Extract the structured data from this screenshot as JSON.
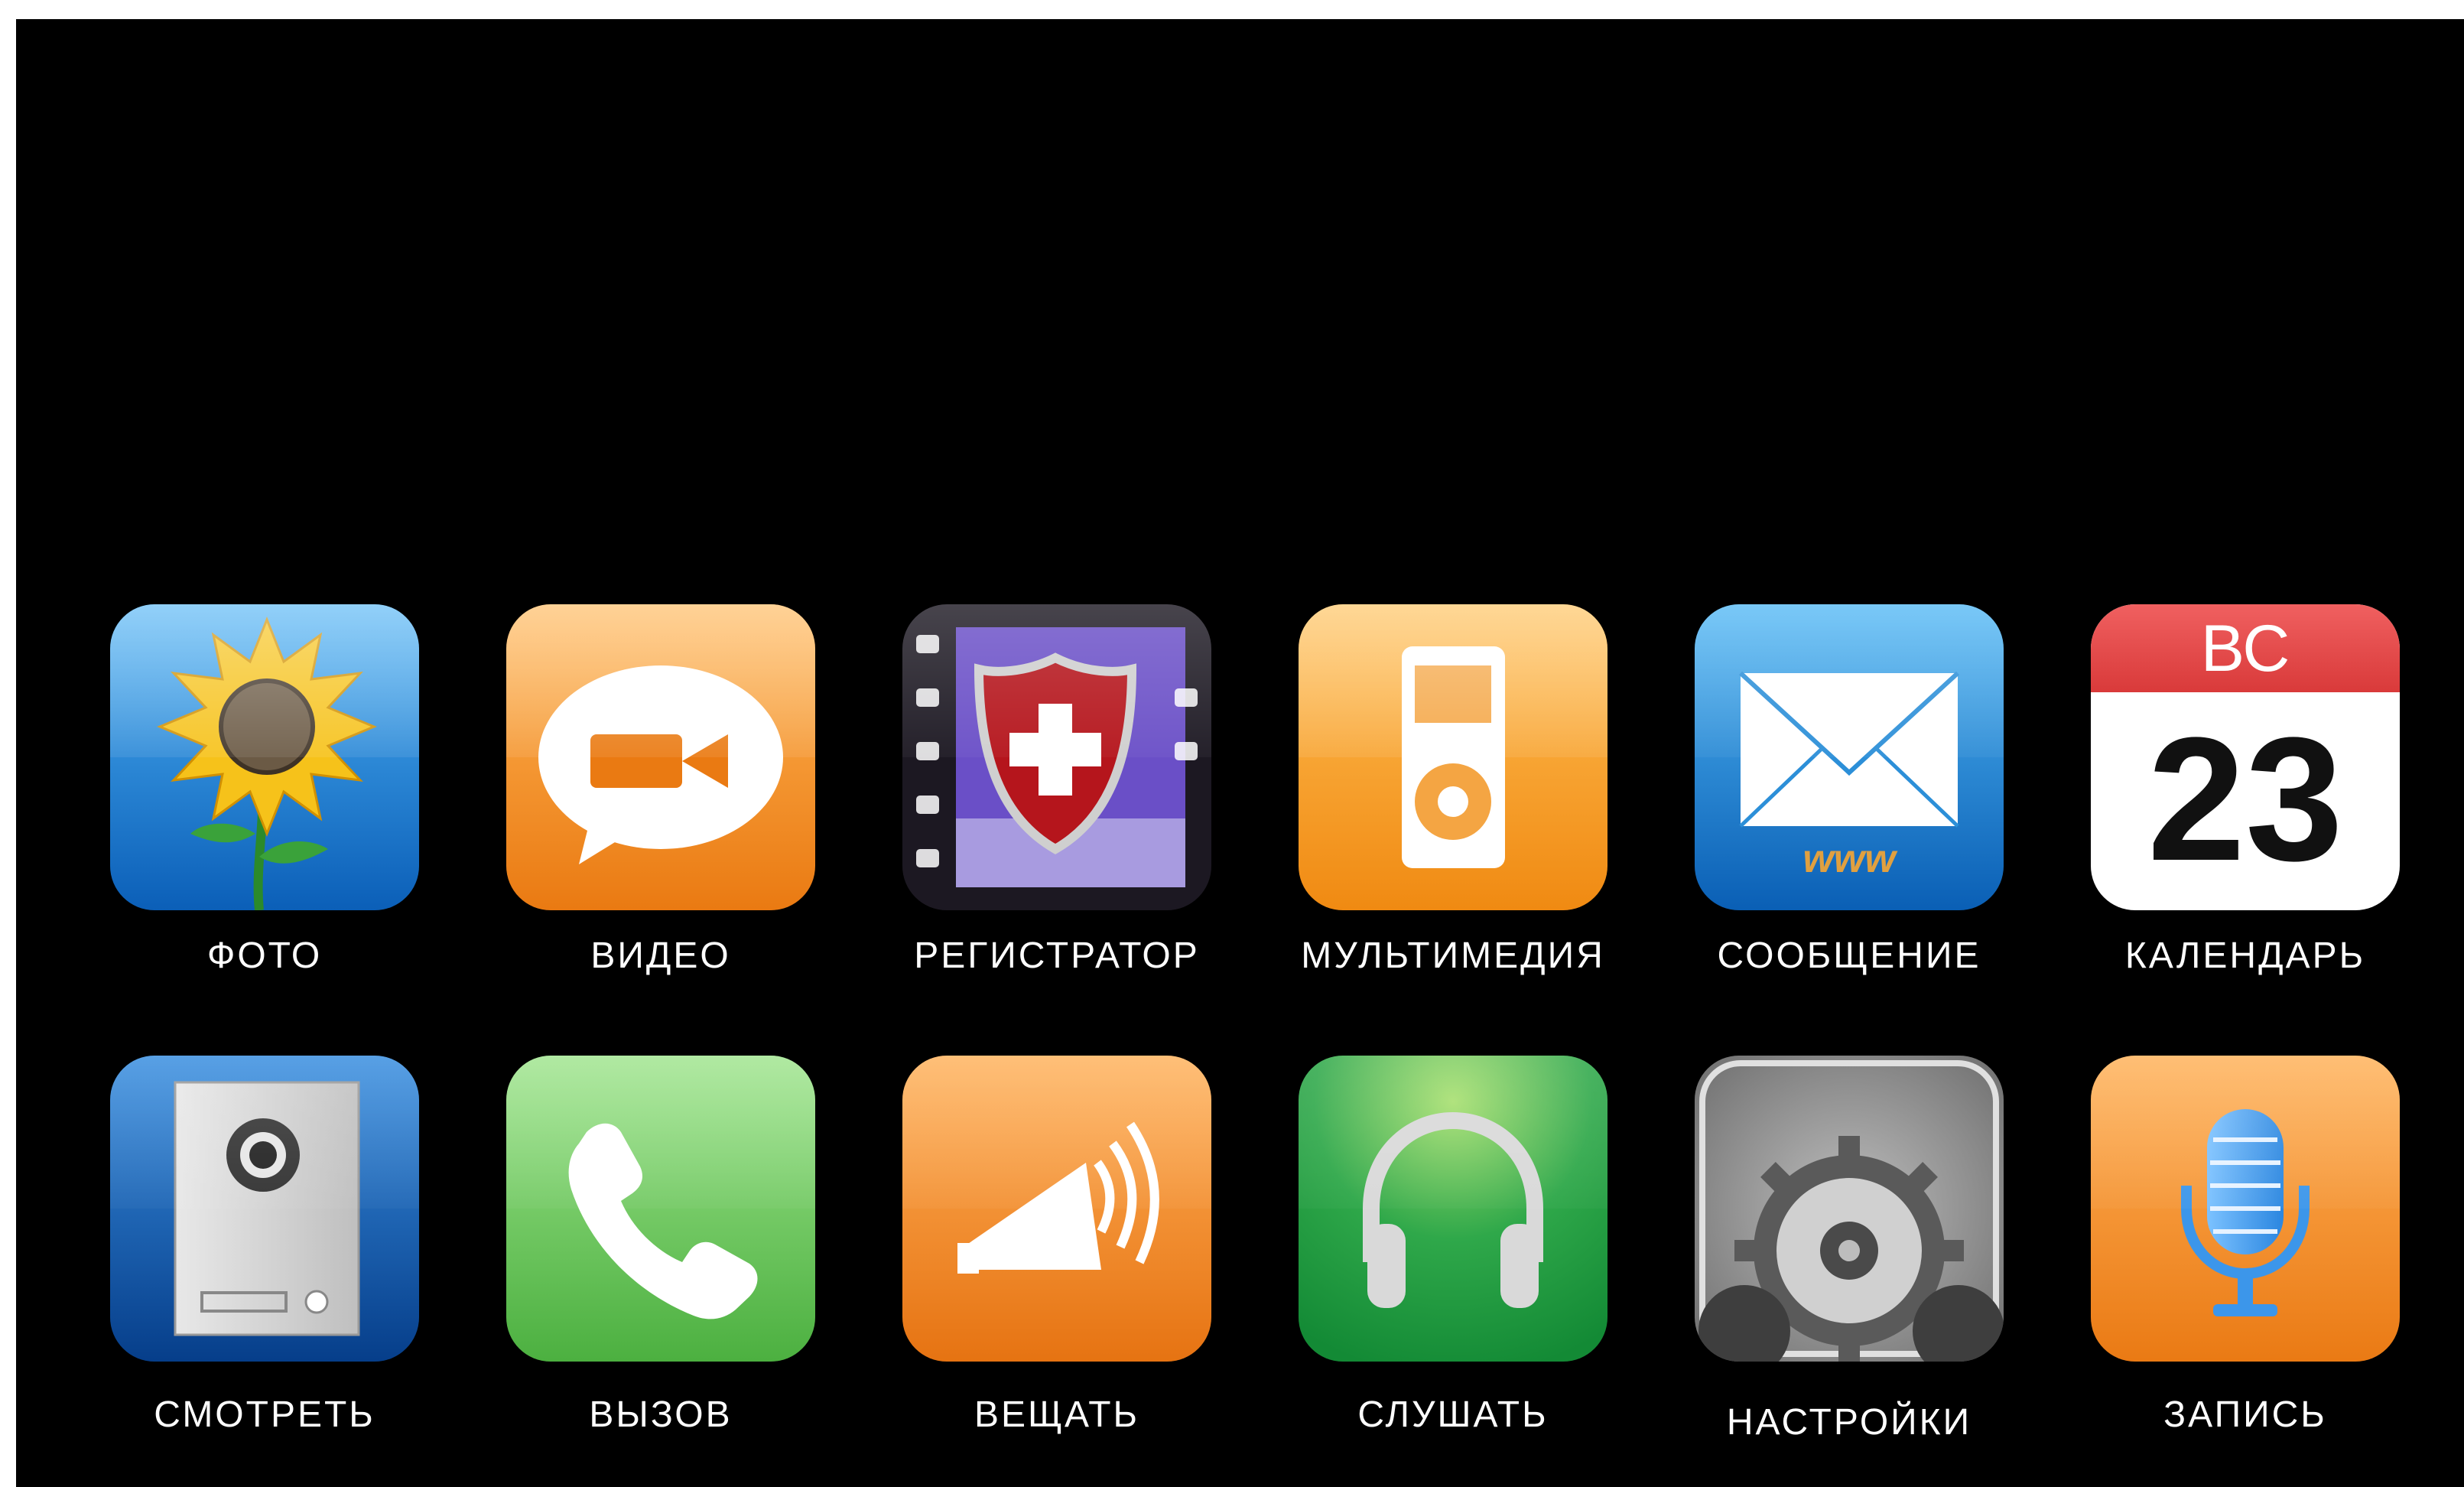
{
  "apps": [
    {
      "label": "ФОТО",
      "icon": "sunflower-photo-icon",
      "color": "#1e7fd6"
    },
    {
      "label": "ВИДЕО",
      "icon": "video-camera-bubble-icon",
      "color": "#f08a1c"
    },
    {
      "label": "РЕГИСТРАТОР",
      "icon": "film-shield-icon",
      "color": "#2a2238"
    },
    {
      "label": "МУЛЬТИМЕДИЯ",
      "icon": "media-player-icon",
      "color": "#f59a1e"
    },
    {
      "label": "СООБЩЕНИЕ",
      "icon": "envelope-icon",
      "color": "#1a7fd0"
    },
    {
      "label": "КАЛЕНДАРЬ",
      "icon": "calendar-icon",
      "color": "#ffffff",
      "calendar_day_name": "ВС",
      "calendar_date": "23"
    },
    {
      "label": "СМОТРЕТЬ",
      "icon": "door-panel-camera-icon",
      "color": "#0d4fa3"
    },
    {
      "label": "ВЫЗОВ",
      "icon": "phone-handset-icon",
      "color": "#5cc24e"
    },
    {
      "label": "ВЕЩАТЬ",
      "icon": "megaphone-icon",
      "color": "#ef7e1b"
    },
    {
      "label": "СЛУШАТЬ",
      "icon": "headphones-icon",
      "color": "#27a845"
    },
    {
      "label": "НАСТРОЙКИ",
      "icon": "gears-icon",
      "color": "#8a8a8a"
    },
    {
      "label": "ЗАПИСЬ",
      "icon": "microphone-icon",
      "color": "#f08a1c"
    }
  ]
}
